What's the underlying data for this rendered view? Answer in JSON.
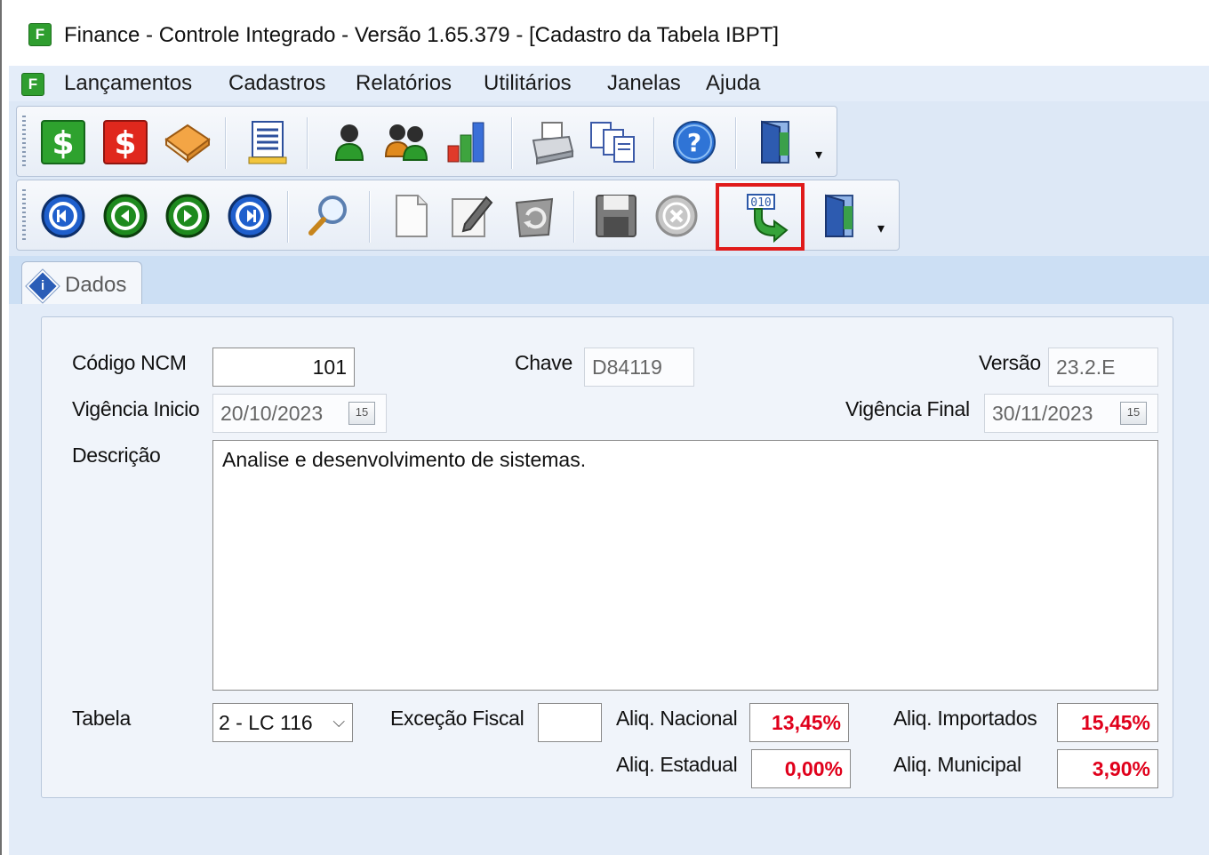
{
  "window": {
    "logo_letter": "F",
    "title": "Finance - Controle Integrado - Versão 1.65.379 - [Cadastro da Tabela IBPT]"
  },
  "menu": {
    "logo_letter": "F",
    "items": [
      "Lançamentos",
      "Cadastros",
      "Relatórios",
      "Utilitários",
      "Janelas",
      "Ajuda"
    ]
  },
  "toolbar_main": {
    "buttons": [
      {
        "icon": "dollar-green-icon"
      },
      {
        "icon": "dollar-red-icon"
      },
      {
        "icon": "book-icon"
      },
      {
        "icon": "report-icon"
      },
      {
        "icon": "person-icon"
      },
      {
        "icon": "people-icon"
      },
      {
        "icon": "bar-chart-icon"
      },
      {
        "icon": "printer-icon"
      },
      {
        "icon": "copy-documents-icon"
      },
      {
        "icon": "help-icon"
      },
      {
        "icon": "exit-door-icon"
      }
    ]
  },
  "toolbar_nav": {
    "buttons": [
      {
        "icon": "first-record-icon"
      },
      {
        "icon": "previous-record-icon"
      },
      {
        "icon": "next-record-icon"
      },
      {
        "icon": "last-record-icon"
      },
      {
        "icon": "search-icon"
      },
      {
        "icon": "new-document-icon"
      },
      {
        "icon": "edit-icon"
      },
      {
        "icon": "delete-icon"
      },
      {
        "icon": "save-icon"
      },
      {
        "icon": "cancel-icon"
      },
      {
        "icon": "import-binary-icon",
        "caption": "010",
        "highlighted": true
      },
      {
        "icon": "exit-door-icon"
      }
    ]
  },
  "tabs": [
    {
      "label": "Dados",
      "active": true,
      "icon": "info-icon"
    }
  ],
  "form": {
    "codigo_ncm": {
      "label": "Código NCM",
      "value": "101"
    },
    "chave": {
      "label": "Chave",
      "value": "D84119"
    },
    "versao": {
      "label": "Versão",
      "value": "23.2.E"
    },
    "vigencia_inicio": {
      "label": "Vigência Inicio",
      "value": "20/10/2023",
      "calendar_label": "15"
    },
    "vigencia_final": {
      "label": "Vigência Final",
      "value": "30/11/2023",
      "calendar_label": "15"
    },
    "descricao": {
      "label": "Descrição",
      "value": "Analise e desenvolvimento de sistemas."
    },
    "tabela": {
      "label": "Tabela",
      "value": "2 - LC 116",
      "chevron": "⌵"
    },
    "excecao_fiscal": {
      "label": "Exceção Fiscal",
      "value": ""
    },
    "aliq_nacional": {
      "label": "Aliq. Nacional",
      "value": "13,45%"
    },
    "aliq_importados": {
      "label": "Aliq. Importados",
      "value": "15,45%"
    },
    "aliq_estadual": {
      "label": "Aliq. Estadual",
      "value": "0,00%"
    },
    "aliq_municipal": {
      "label": "Aliq. Municipal",
      "value": "3,90%"
    }
  },
  "colors": {
    "highlight": "#e01a1a",
    "rate_text": "#e0001b",
    "menubar": "#e4edf9",
    "app_green": "#2f9e2f"
  }
}
